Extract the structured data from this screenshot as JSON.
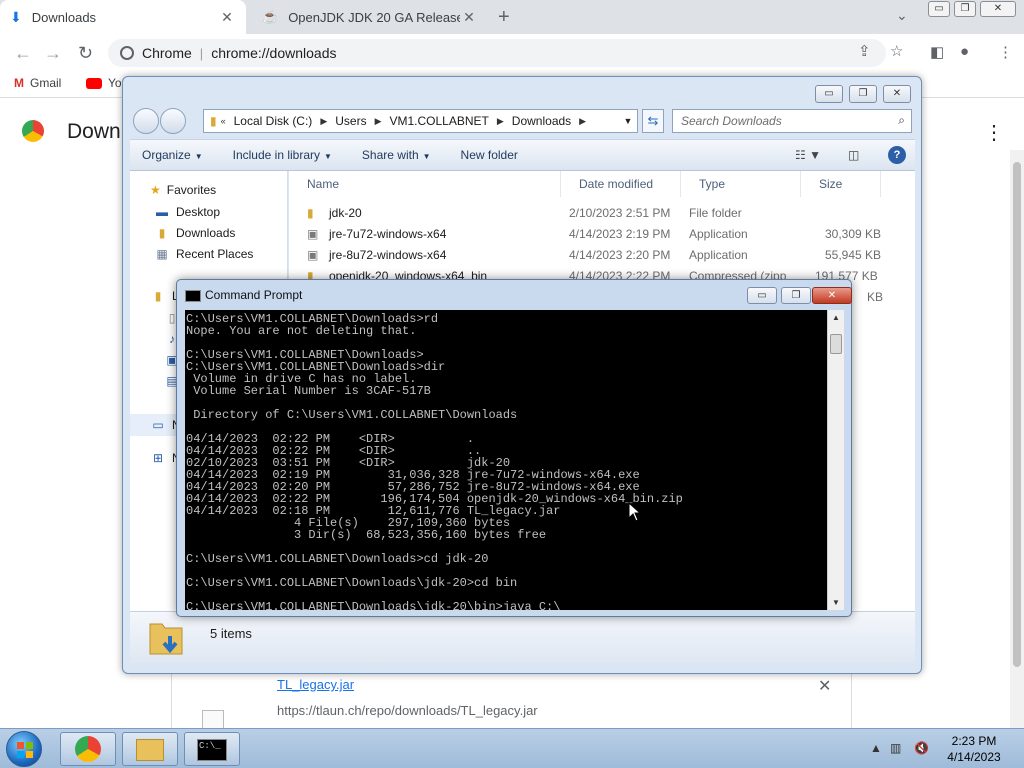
{
  "chrome": {
    "tabs": [
      {
        "title": "Downloads",
        "active": true
      },
      {
        "title": "OpenJDK JDK 20 GA Release",
        "active": false
      }
    ],
    "site_chip": "Chrome",
    "url": "chrome://downloads",
    "bookmarks": [
      {
        "label": "Gmail"
      },
      {
        "label": "Yo"
      }
    ],
    "page_title": "Down",
    "download": {
      "file_name": "TL_legacy.jar",
      "url": "https://tlaun.ch/repo/downloads/TL_legacy.jar"
    }
  },
  "explorer": {
    "breadcrumb": [
      "Local Disk (C:)",
      "Users",
      "VM1.COLLABNET",
      "Downloads"
    ],
    "search_placeholder": "Search Downloads",
    "commands": [
      "Organize",
      "Include in library",
      "Share with",
      "New folder"
    ],
    "nav_pane": {
      "favorites": "Favorites",
      "items": [
        "Desktop",
        "Downloads",
        "Recent Places"
      ],
      "partial": [
        "L",
        "N",
        "N"
      ]
    },
    "columns": [
      "Name",
      "Date modified",
      "Type",
      "Size"
    ],
    "rows": [
      {
        "name": "jdk-20",
        "date": "2/10/2023 2:51 PM",
        "type": "File folder",
        "size": ""
      },
      {
        "name": "jre-7u72-windows-x64",
        "date": "4/14/2023 2:19 PM",
        "type": "Application",
        "size": "30,309 KB"
      },
      {
        "name": "jre-8u72-windows-x64",
        "date": "4/14/2023 2:20 PM",
        "type": "Application",
        "size": "55,945 KB"
      },
      {
        "name": "openjdk-20_windows-x64_bin",
        "date": "4/14/2023 2:22 PM",
        "type": "Compressed (zipp",
        "size": "191,577 KB"
      },
      {
        "name": "",
        "date": "",
        "type": "",
        "size": "KB"
      }
    ],
    "item_count": "5 items"
  },
  "cmd": {
    "title": "Command Prompt",
    "lines": "C:\\Users\\VM1.COLLABNET\\Downloads>rd\nNope. You are not deleting that.\n\nC:\\Users\\VM1.COLLABNET\\Downloads>\nC:\\Users\\VM1.COLLABNET\\Downloads>dir\n Volume in drive C has no label.\n Volume Serial Number is 3CAF-517B\n\n Directory of C:\\Users\\VM1.COLLABNET\\Downloads\n\n04/14/2023  02:22 PM    <DIR>          .\n04/14/2023  02:22 PM    <DIR>          ..\n02/10/2023  03:51 PM    <DIR>          jdk-20\n04/14/2023  02:19 PM        31,036,328 jre-7u72-windows-x64.exe\n04/14/2023  02:20 PM        57,286,752 jre-8u72-windows-x64.exe\n04/14/2023  02:22 PM       196,174,504 openjdk-20_windows-x64_bin.zip\n04/14/2023  02:18 PM        12,611,776 TL_legacy.jar\n               4 File(s)    297,109,360 bytes\n               3 Dir(s)  68,523,356,160 bytes free\n\nC:\\Users\\VM1.COLLABNET\\Downloads>cd jdk-20\n\nC:\\Users\\VM1.COLLABNET\\Downloads\\jdk-20>cd bin\n\nC:\\Users\\VM1.COLLABNET\\Downloads\\jdk-20\\bin>java C:\\"
  },
  "taskbar": {
    "time": "2:23 PM",
    "date": "4/14/2023"
  },
  "colors": {
    "chrome_blue": "#1a73e8",
    "console_bg": "#000000",
    "console_text": "#c0c0c0"
  }
}
